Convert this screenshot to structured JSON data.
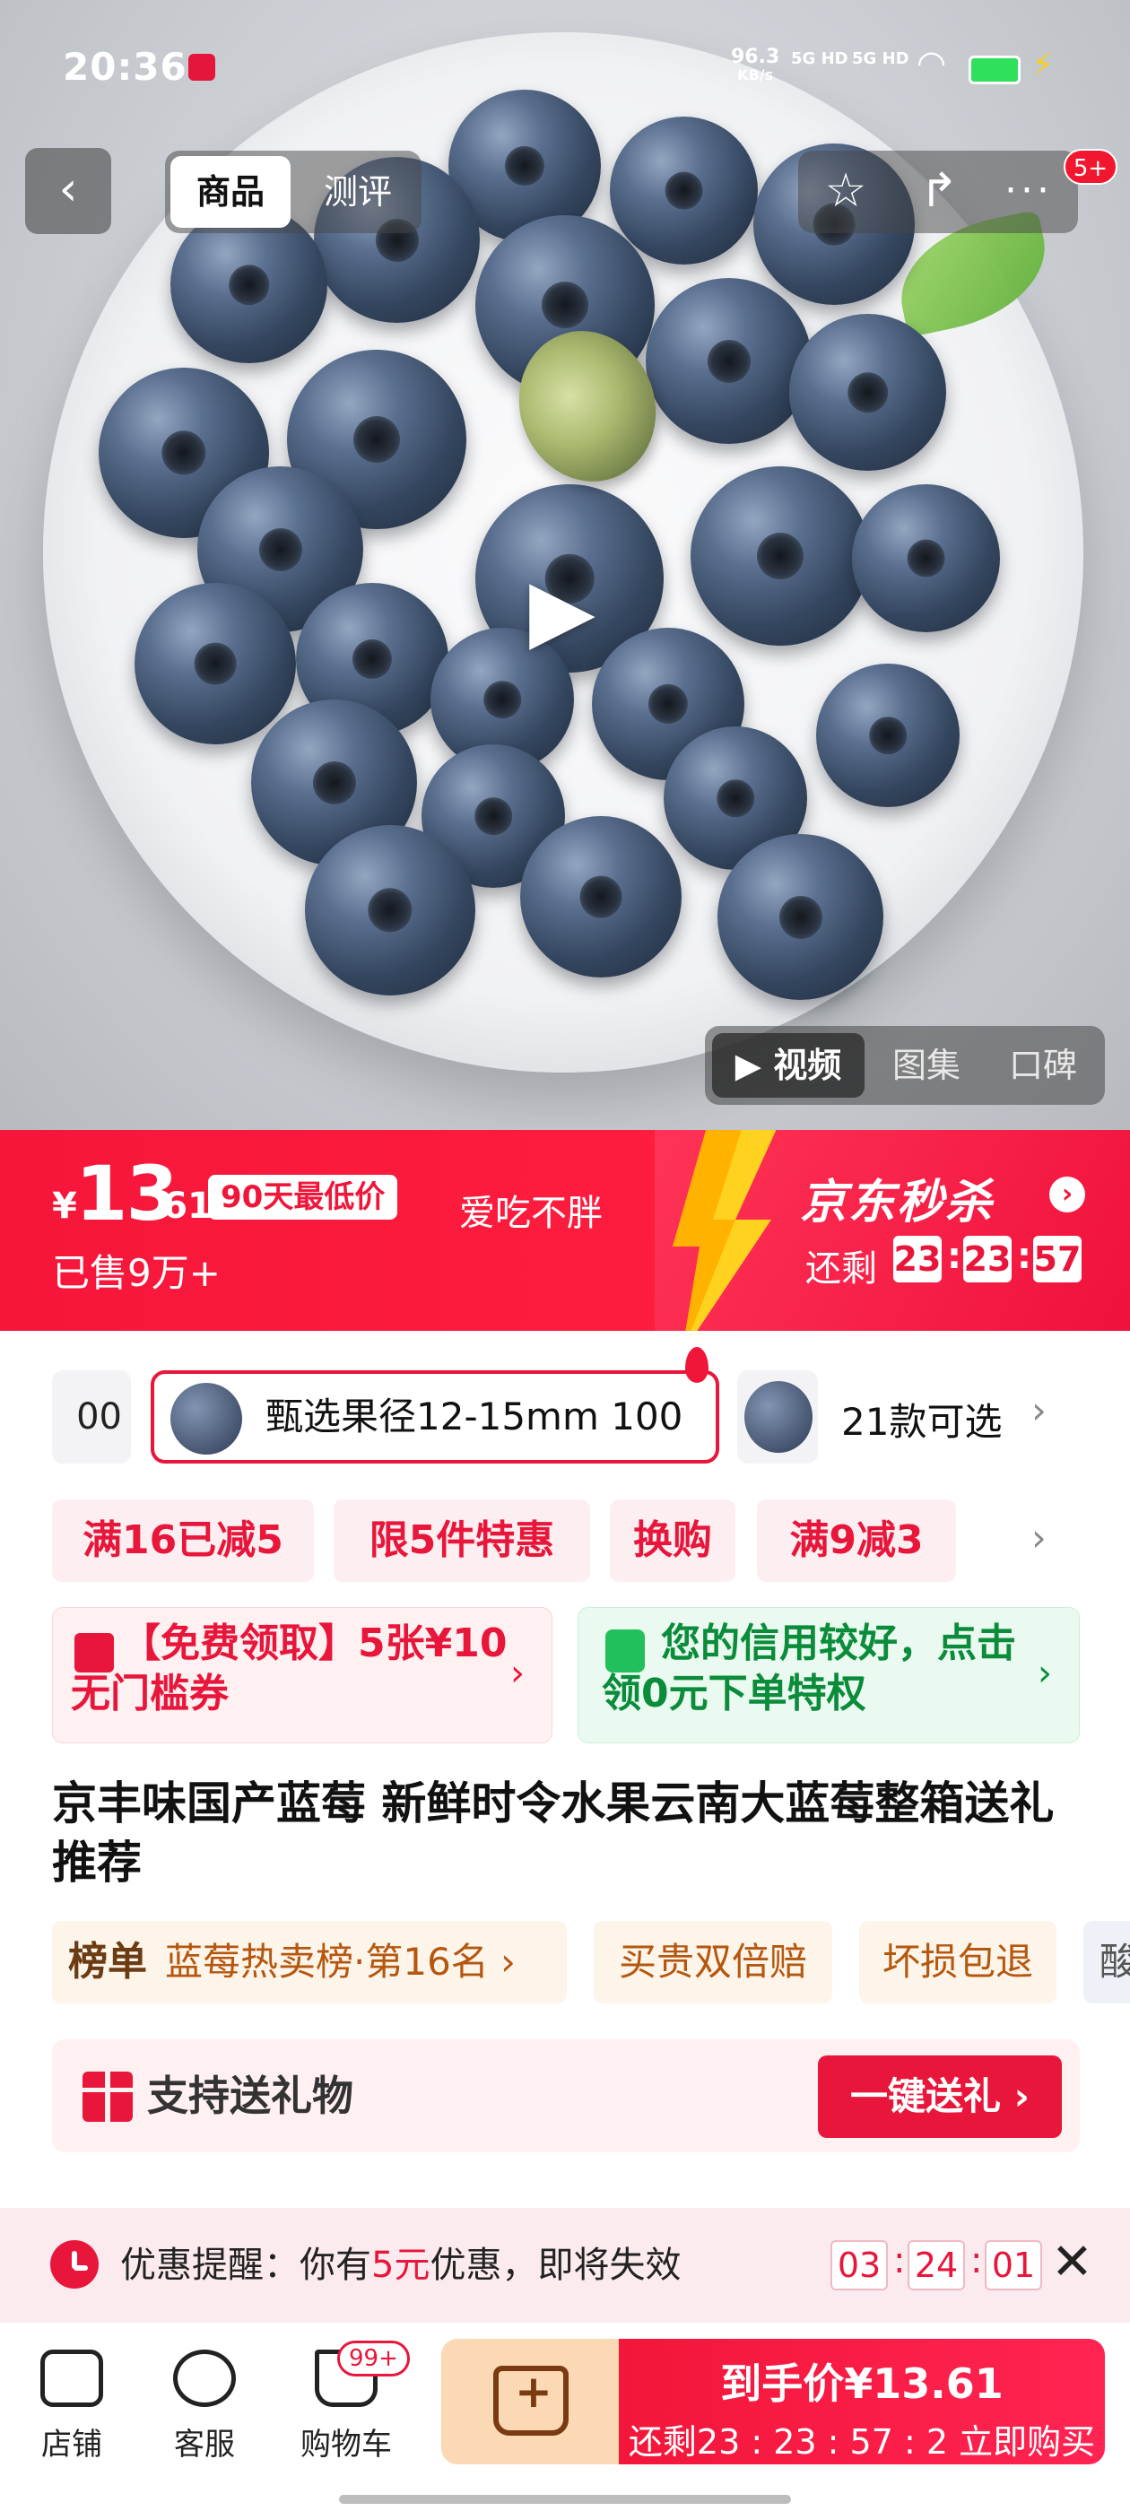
{
  "status_bar": {
    "time": "20:36",
    "net_speed_value": "96.3",
    "net_speed_unit": "KB/s",
    "signal_1": "5G HD",
    "signal_2": "5G HD"
  },
  "top_nav": {
    "tab_goods": "商品",
    "tab_review": "测评",
    "badge": "5+"
  },
  "media_tabs": {
    "video": "▶ 视频",
    "gallery": "图集",
    "reputation": "口碑"
  },
  "price_banner": {
    "currency": "¥",
    "price_int": "13",
    "price_dec": ".61",
    "lowest_tag": "90天最低价",
    "slogan": "爱吃不胖",
    "sold": "已售9万+",
    "seckill_title": "京东秒杀",
    "remain_label": "还剩",
    "countdown": [
      "23",
      "23",
      "57"
    ],
    "colors": {
      "primary": "#f5163a",
      "accent": "#ffffff"
    }
  },
  "variants": {
    "prev_text": "00",
    "selected_text": "甄选果径12-15mm 100",
    "count_text": "21款可选"
  },
  "promos": [
    "满16已减5",
    "限5件特惠",
    "换购",
    "满9减3"
  ],
  "coupon": {
    "text": "【免费领取】5张¥10无门槛券"
  },
  "credit": {
    "text": "您的信用较好，点击领0元下单特权"
  },
  "product_title": "京丰味国产蓝莓 新鲜时令水果云南大蓝莓整箱送礼推荐",
  "tags": {
    "rank_label": "榜单",
    "rank_text": "蓝莓热卖榜·第16名 ›",
    "tag1": "买贵双倍赔",
    "tag2": "坏损包退",
    "tag3": "酸"
  },
  "gift": {
    "label": "支持送礼物",
    "button": "一键送礼 ›"
  },
  "reminder": {
    "prefix": "优惠提醒：你有",
    "amount": "5元",
    "suffix": "优惠，即将失效",
    "countdown": [
      "03",
      "24",
      "01"
    ]
  },
  "bottom_bar": {
    "store": "店铺",
    "service": "客服",
    "cart": "购物车",
    "cart_badge": "99+",
    "buy_line1": "到手价¥13.61",
    "buy_line2": "还剩23 : 23 : 57 : 2  立即购买"
  }
}
